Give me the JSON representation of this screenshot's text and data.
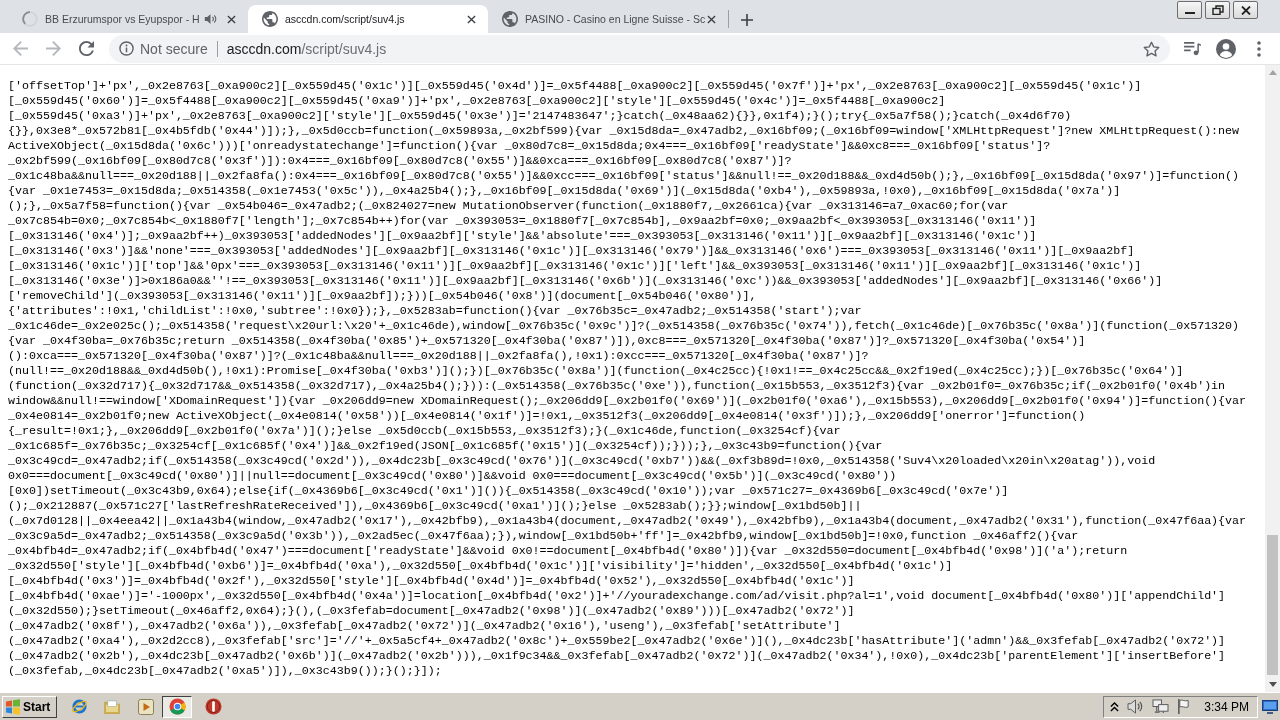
{
  "window": {
    "tabs": [
      {
        "title": "BB Erzurumspor vs Eyupspor - H",
        "selected": false,
        "loading": true,
        "audio": true
      },
      {
        "title": "asccdn.com/script/suv4.js",
        "selected": true,
        "loading": false,
        "audio": false
      },
      {
        "title": "PASINO - Casino en Ligne Suisse - Sc",
        "selected": false,
        "loading": false,
        "audio": false
      }
    ]
  },
  "toolbar": {
    "security_label": "Not secure",
    "url_host": "asccdn.com",
    "url_path": "/script/suv4.js"
  },
  "page": {
    "lines": [
      "['offsetTop']+'px',_0x2e8763[_0xa900c2][_0x559d45('0x1c')][_0x559d45('0x4d')]=_0x5f4488[_0xa900c2][_0x559d45('0x7f')]+'px',_0x2e8763[_0xa900c2][_0x559d45('0x1c')]",
      "[_0x559d45('0x60')]=_0x5f4488[_0xa900c2][_0x559d45('0xa9')]+'px',_0x2e8763[_0xa900c2]['style'][_0x559d45('0x4c')]=_0x5f4488[_0xa900c2]",
      "[_0x559d45('0xa3')]+'px',_0x2e8763[_0xa900c2]['style'][_0x559d45('0x3e')]='2147483647';}catch(_0x48aa62){}},0x1f4);}();try{_0x5a7f58();}catch(_0x4d6f70)",
      "{}},0x3e8*_0x572b81[_0x4b5fdb('0x44')]);},_0x5d0ccb=function(_0x59893a,_0x2bf599){var _0x15d8da=_0x47adb2,_0x16bf09;(_0x16bf09=window['XMLHttpRequest']?new XMLHttpRequest():new",
      "ActiveXObject(_0x15d8da('0x6c')))['onreadystatechange']=function(){var _0x80d7c8=_0x15d8da;0x4===_0x16bf09['readyState']&&0xc8===_0x16bf09['status']?",
      "_0x2bf599(_0x16bf09[_0x80d7c8('0x3f')]):0x4===_0x16bf09[_0x80d7c8('0x55')]&&0xca===_0x16bf09[_0x80d7c8('0x87')]?",
      "_0x1c48ba&&null===_0x20d188||_0x2fa8fa():0x4===_0x16bf09[_0x80d7c8('0x55')]&&0xcc===_0x16bf09['status']&&null!==_0x20d188&&_0xd4d50b();},_0x16bf09[_0x15d8da('0x97')]=function()",
      "{var _0x1e7453=_0x15d8da;_0x514358(_0x1e7453('0x5c')),_0x4a25b4();},_0x16bf09[_0x15d8da('0x69')](_0x15d8da('0xb4'),_0x59893a,!0x0),_0x16bf09[_0x15d8da('0x7a')]",
      "();},_0x5a7f58=function(){var _0x54b046=_0x47adb2;(_0x824027=new MutationObserver(function(_0x1880f7,_0x2661ca){var _0x313146=a7_0xac60;for(var",
      "_0x7c854b=0x0;_0x7c854b<_0x1880f7['length'];_0x7c854b++)for(var _0x393053=_0x1880f7[_0x7c854b],_0x9aa2bf=0x0;_0x9aa2bf<_0x393053[_0x313146('0x11')]",
      "[_0x313146('0x4')];_0x9aa2bf++)_0x393053['addedNodes'][_0x9aa2bf]['style']&&'absolute'===_0x393053[_0x313146('0x11')][_0x9aa2bf][_0x313146('0x1c')]",
      "[_0x313146('0x3')]&&'none'===_0x393053['addedNodes'][_0x9aa2bf][_0x313146('0x1c')][_0x313146('0x79')]&&_0x313146('0x6')===_0x393053[_0x313146('0x11')][_0x9aa2bf]",
      "[_0x313146('0x1c')]['top']&&'0px'===_0x393053[_0x313146('0x11')][_0x9aa2bf][_0x313146('0x1c')]['left']&&_0x393053[_0x313146('0x11')][_0x9aa2bf][_0x313146('0x1c')]",
      "[_0x313146('0x3e')]>0x186a0&&''!==_0x393053[_0x313146('0x11')][_0x9aa2bf][_0x313146('0x6b')](_0x313146('0xc'))&&_0x393053['addedNodes'][_0x9aa2bf][_0x313146('0x66')]",
      "['removeChild'](_0x393053[_0x313146('0x11')][_0x9aa2bf]);}))[_0x54b046('0x8')](document[_0x54b046('0x80')],",
      "{'attributes':!0x1,'childList':!0x0,'subtree':!0x0});},_0x5283ab=function(){var _0x76b35c=_0x47adb2;_0x514358('start');var",
      "_0x1c46de=_0x2e025c();_0x514358('request\\x20url:\\x20'+_0x1c46de),window[_0x76b35c('0x9c')]?(_0x514358(_0x76b35c('0x74')),fetch(_0x1c46de)[_0x76b35c('0x8a')](function(_0x571320)",
      "{var _0x4f30ba=_0x76b35c;return _0x514358(_0x4f30ba('0x85')+_0x571320[_0x4f30ba('0x87')]),0xc8===_0x571320[_0x4f30ba('0x87')]?_0x571320[_0x4f30ba('0x54')]",
      "():0xca===_0x571320[_0x4f30ba('0x87')]?(_0x1c48ba&&null===_0x20d188||_0x2fa8fa(),!0x1):0xcc===_0x571320[_0x4f30ba('0x87')]?",
      "(null!==_0x20d188&&_0xd4d50b(),!0x1):Promise[_0x4f30ba('0xb3')]();})[_0x76b35c('0x8a')](function(_0x4c25cc){!0x1!==_0x4c25cc&&_0x2f19ed(_0x4c25cc);})[_0x76b35c('0x64')]",
      "(function(_0x32d717){_0x32d717&&_0x514358(_0x32d717),_0x4a25b4();})):(_0x514358(_0x76b35c('0xe')),function(_0x15b553,_0x3512f3){var _0x2b01f0=_0x76b35c;if(_0x2b01f0('0x4b')in",
      "window&&null!==window['XDomainRequest']){var _0x206dd9=new XDomainRequest();_0x206dd9[_0x2b01f0('0x69')](_0x2b01f0('0xa6'),_0x15b553),_0x206dd9[_0x2b01f0('0x94')]=function(){var",
      "_0x4e0814=_0x2b01f0;new ActiveXObject(_0x4e0814('0x58'))[_0x4e0814('0x1f')]=!0x1,_0x3512f3(_0x206dd9[_0x4e0814('0x3f')]);},_0x206dd9['onerror']=function()",
      "{_result=!0x1;},_0x206dd9[_0x2b01f0('0x7a')]();}else _0x5d0ccb(_0x15b553,_0x3512f3);}(_0x1c46de,function(_0x3254cf){var",
      "_0x1c685f=_0x76b35c;_0x3254cf[_0x1c685f('0x4')]&&_0x2f19ed(JSON[_0x1c685f('0x15')](_0x3254cf));}));},_0x3c43b9=function(){var",
      "_0x3c49cd=_0x47adb2;if(_0x514358(_0x3c49cd('0x2d')),_0x4dc23b[_0x3c49cd('0x76')](_0x3c49cd('0xb7'))&&(_0xf3b89d=!0x0,_0x514358('Suv4\\x20loaded\\x20in\\x20atag')),void",
      "0x0===document[_0x3c49cd('0x80')]||null==document[_0x3c49cd('0x80')]&&void 0x0===document[_0x3c49cd('0x5b')](_0x3c49cd('0x80'))",
      "[0x0])setTimeout(_0x3c43b9,0x64);else{if(_0x4369b6[_0x3c49cd('0x1')]()){_0x514358(_0x3c49cd('0x10'));var _0x571c27=_0x4369b6[_0x3c49cd('0x7e')]",
      "();_0x212887(_0x571c27['lastRefreshRateReceived']),_0x4369b6[_0x3c49cd('0xa1')]();}else _0x5283ab();}};window[_0x1bd50b]||",
      "(_0x7d0128||_0x4eea42||_0x1a43b4(window,_0x47adb2('0x17'),_0x42bfb9),_0x1a43b4(document,_0x47adb2('0x49'),_0x42bfb9),_0x1a43b4(document,_0x47adb2('0x31'),function(_0x47f6aa){var",
      "_0x3c9a5d=_0x47adb2;_0x514358(_0x3c9a5d('0x3b')),_0x2ad5ec(_0x47f6aa);}),window[_0x1bd50b+'ff']=_0x42bfb9,window[_0x1bd50b]=!0x0,function _0x46aff2(){var",
      "_0x4bfb4d=_0x47adb2;if(_0x4bfb4d('0x47')===document['readyState']&&void 0x0!==document[_0x4bfb4d('0x80')]){var _0x32d550=document[_0x4bfb4d('0x98')]('a');return",
      "_0x32d550['style'][_0x4bfb4d('0xb6')]=_0x4bfb4d('0xa'),_0x32d550[_0x4bfb4d('0x1c')]['visibility']='hidden',_0x32d550[_0x4bfb4d('0x1c')]",
      "[_0x4bfb4d('0x3')]=_0x4bfb4d('0x2f'),_0x32d550['style'][_0x4bfb4d('0x4d')]=_0x4bfb4d('0x52'),_0x32d550[_0x4bfb4d('0x1c')]",
      "[_0x4bfb4d('0xae')]='-1000px',_0x32d550[_0x4bfb4d('0x4a')]=location[_0x4bfb4d('0x2')]+'//youradexchange.com/ad/visit.php?al=1',void document[_0x4bfb4d('0x80')]['appendChild']",
      "(_0x32d550);}setTimeout(_0x46aff2,0x64);}(),(_0x3fefab=document[_0x47adb2('0x98')](_0x47adb2('0x89')))[_0x47adb2('0x72')]",
      "(_0x47adb2('0x8f'),_0x47adb2('0x6a')),_0x3fefab[_0x47adb2('0x72')](_0x47adb2('0x16'),'useng'),_0x3fefab['setAttribute']",
      "(_0x47adb2('0xa4'),_0x2d2cc8),_0x3fefab['src']='//'+_0x5a5cf4+_0x47adb2('0x8c')+_0x559be2[_0x47adb2('0x6e')](),_0x4dc23b['hasAttribute']('admn')&&_0x3fefab[_0x47adb2('0x72')]",
      "(_0x47adb2('0x2b'),_0x4dc23b[_0x47adb2('0x6b')](_0x47adb2('0x2b'))),_0x1f9c34&&_0x3fefab[_0x47adb2('0x72')](_0x47adb2('0x34'),!0x0),_0x4dc23b['parentElement']['insertBefore']",
      "(_0x3fefab,_0x4dc23b[_0x47adb2('0xa5')]),_0x3c43b9());}();}]);"
    ]
  },
  "taskbar": {
    "start_label": "Start",
    "tasks": [
      {
        "selected": true
      },
      {
        "selected": false
      }
    ],
    "clock": "3:34 PM"
  }
}
